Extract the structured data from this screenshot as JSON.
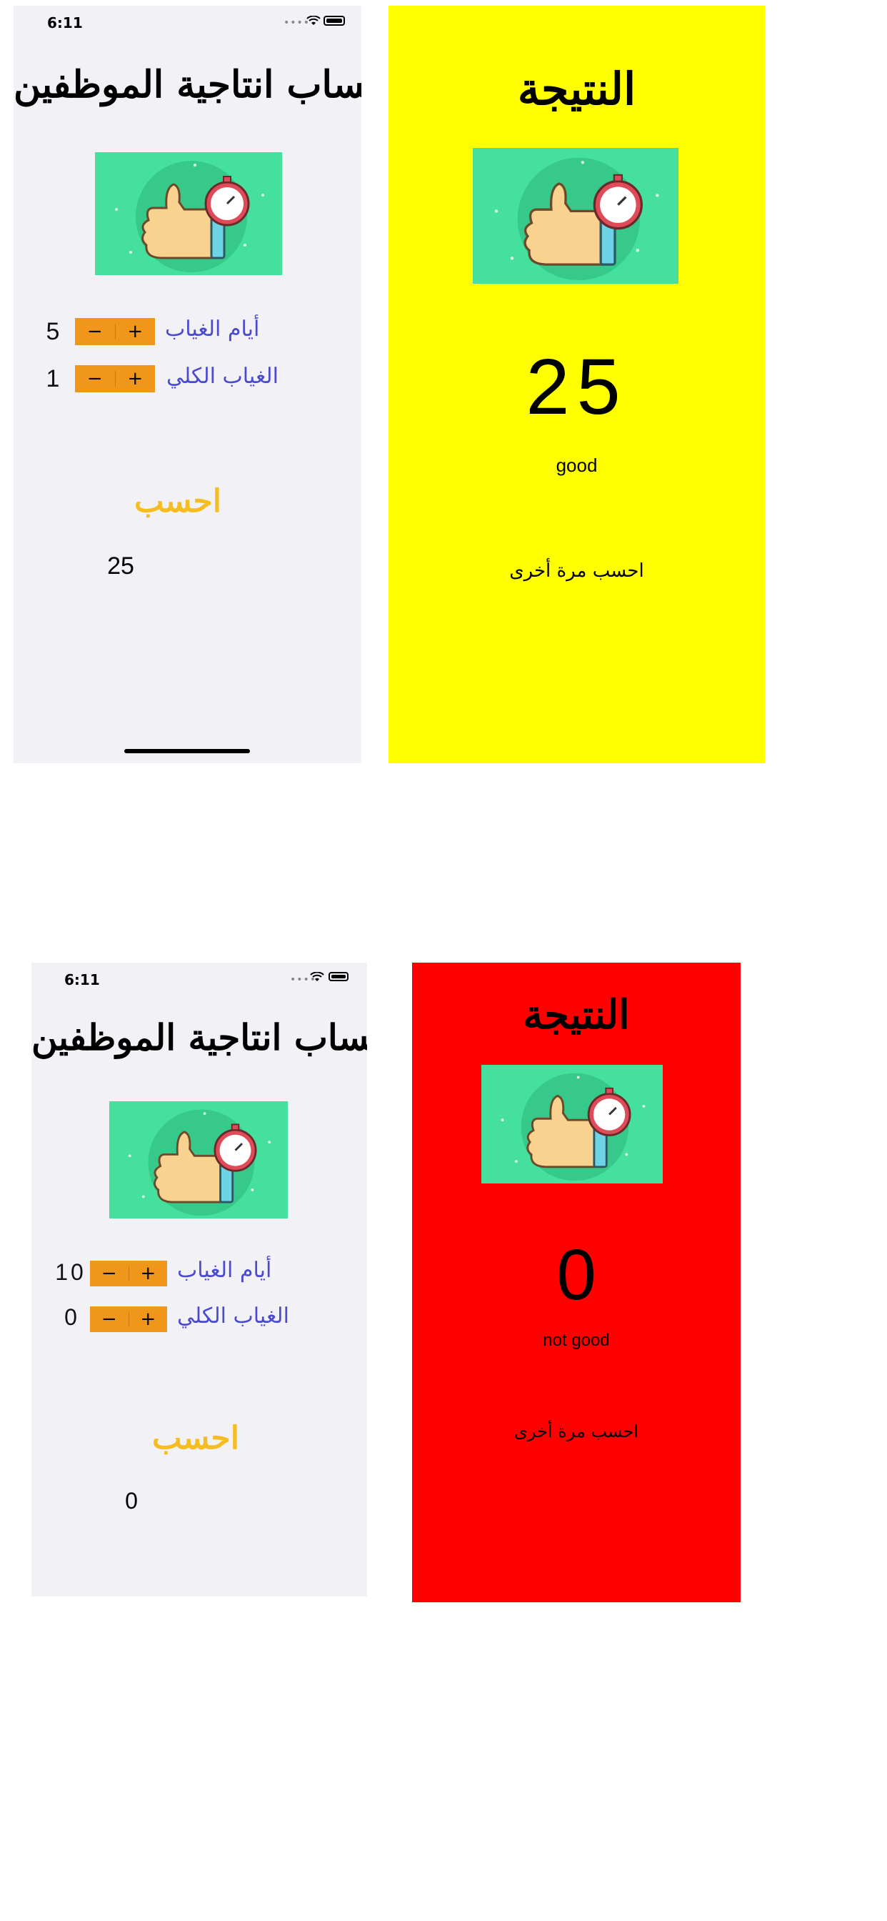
{
  "screens": [
    {
      "status_time": "6:11",
      "title": "حساب انتاجية الموظفين",
      "image": "thumbs-up-stopwatch-illustration",
      "rows": [
        {
          "value": "5",
          "label": "أيام الغياب",
          "minus": "−",
          "plus": "+"
        },
        {
          "value": "1",
          "label": "الغياب الكلي",
          "minus": "−",
          "plus": "+"
        }
      ],
      "calculate_label": "احسب",
      "result_value": "25"
    },
    {
      "status_time": "6:11",
      "title": "حساب انتاجية الموظفين",
      "image": "thumbs-up-stopwatch-illustration",
      "rows": [
        {
          "value": "10",
          "label": "أيام الغياب",
          "minus": "−",
          "plus": "+"
        },
        {
          "value": "0",
          "label": "الغياب الكلي",
          "minus": "−",
          "plus": "+"
        }
      ],
      "calculate_label": "احسب",
      "result_value": "0"
    }
  ],
  "results": [
    {
      "title": "النتيجة",
      "value": "25",
      "status": "good",
      "again_label": "احسب مرة أخرى",
      "background": "#ffff00"
    },
    {
      "title": "النتيجة",
      "value": "0",
      "status": "not good",
      "again_label": "احسب مرة أخرى",
      "background": "#ff0000"
    }
  ],
  "colors": {
    "screen_bg": "#f2f1f6",
    "stepper": "#f0961a",
    "label": "#4a4ad0",
    "calculate": "#f5bd1f",
    "illustration_bg": "#45e09e"
  }
}
